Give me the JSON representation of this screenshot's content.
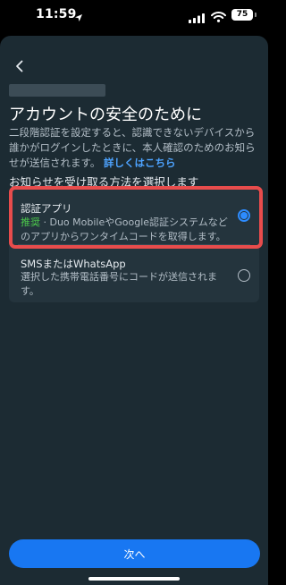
{
  "status_bar": {
    "time": "11:59",
    "battery": "75"
  },
  "header": {
    "title": "アカウントの安全のために",
    "description": "二段階認証を設定すると、認識できないデバイスから誰かがログインしたときに、本人確認のためのお知らせが送信されます。",
    "learn_more": "詳しくはこちら"
  },
  "methods": {
    "heading": "お知らせを受け取る方法を選択します",
    "options": [
      {
        "title": "認証アプリ",
        "badge": "推奨",
        "description": " · Duo MobileやGoogle認証システムなどのアプリからワンタイムコードを取得します。",
        "selected": true
      },
      {
        "title": "SMSまたはWhatsApp",
        "description": "選択した携帯電話番号にコードが送信されます。",
        "selected": false
      }
    ]
  },
  "footer": {
    "next_label": "次へ"
  },
  "colors": {
    "accent": "#1877f2",
    "recommended": "#4cc94c",
    "highlight": "#e84c4c",
    "sheet_background": "#1c2b33"
  }
}
